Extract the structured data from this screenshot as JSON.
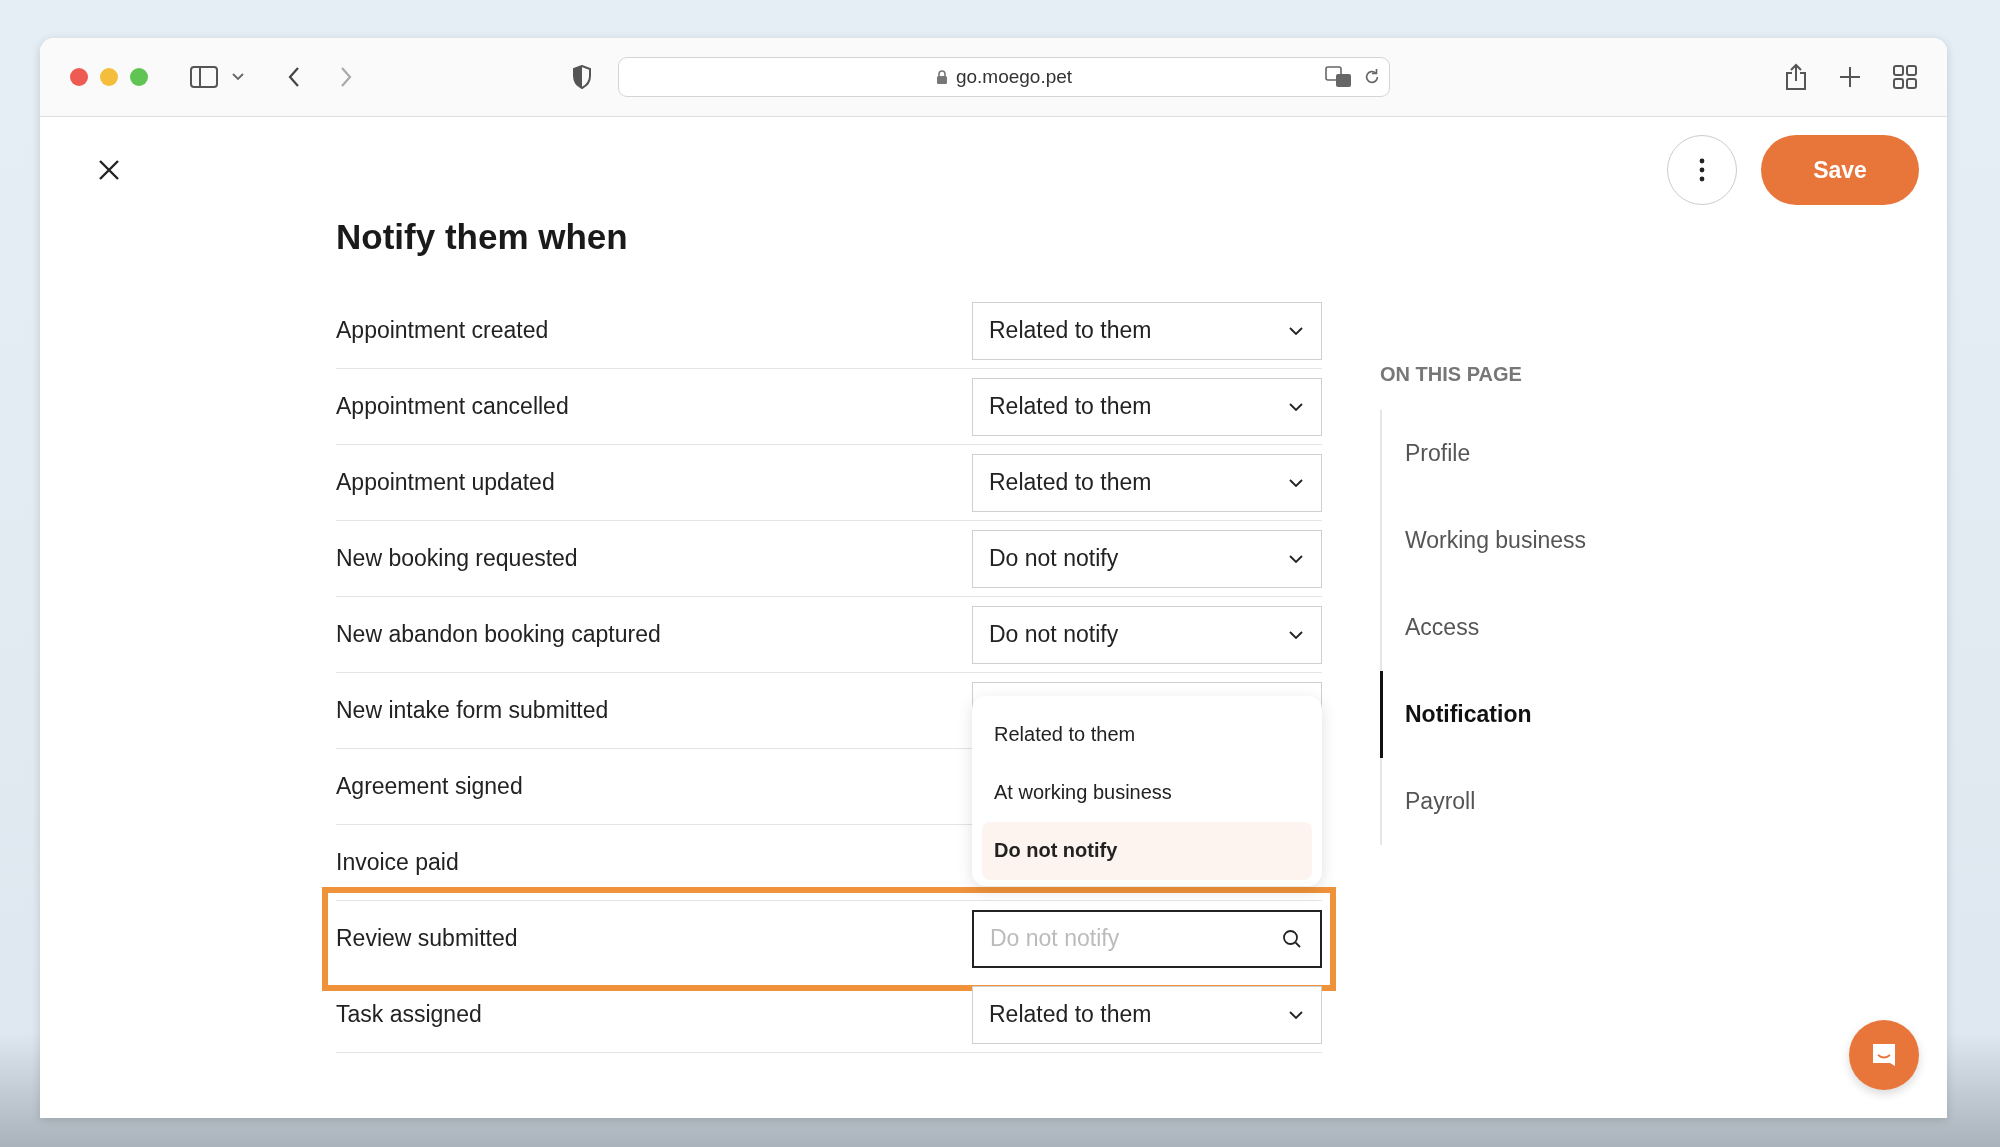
{
  "browser": {
    "url": "go.moego.pet"
  },
  "header": {
    "save_label": "Save"
  },
  "section_title": "Notify them when",
  "rows": [
    {
      "label": "Appointment created",
      "kind": "select",
      "value": "Related to them",
      "highlighted": false
    },
    {
      "label": "Appointment cancelled",
      "kind": "select",
      "value": "Related to them",
      "highlighted": false
    },
    {
      "label": "Appointment updated",
      "kind": "select",
      "value": "Related to them",
      "highlighted": false
    },
    {
      "label": "New booking requested",
      "kind": "select",
      "value": "Do not notify",
      "highlighted": false
    },
    {
      "label": "New abandon booking captured",
      "kind": "select",
      "value": "Do not notify",
      "highlighted": false
    },
    {
      "label": "New intake form submitted",
      "kind": "covered",
      "highlighted": false
    },
    {
      "label": "Agreement signed",
      "kind": "hidden",
      "highlighted": false
    },
    {
      "label": "Invoice paid",
      "kind": "hidden",
      "highlighted": false
    },
    {
      "label": "Review submitted",
      "kind": "search",
      "placeholder": "Do not notify",
      "highlighted": true
    },
    {
      "label": "Task assigned",
      "kind": "select",
      "value": "Related to them",
      "highlighted": false
    }
  ],
  "dropdown": {
    "options": [
      {
        "label": "Related to them",
        "selected": false
      },
      {
        "label": "At working business",
        "selected": false
      },
      {
        "label": "Do not notify",
        "selected": true
      }
    ]
  },
  "toc": {
    "title": "ON THIS PAGE",
    "items": [
      {
        "label": "Profile",
        "selected": false
      },
      {
        "label": "Working business",
        "selected": false
      },
      {
        "label": "Access",
        "selected": false
      },
      {
        "label": "Notification",
        "selected": true
      },
      {
        "label": "Payroll",
        "selected": false
      }
    ]
  }
}
